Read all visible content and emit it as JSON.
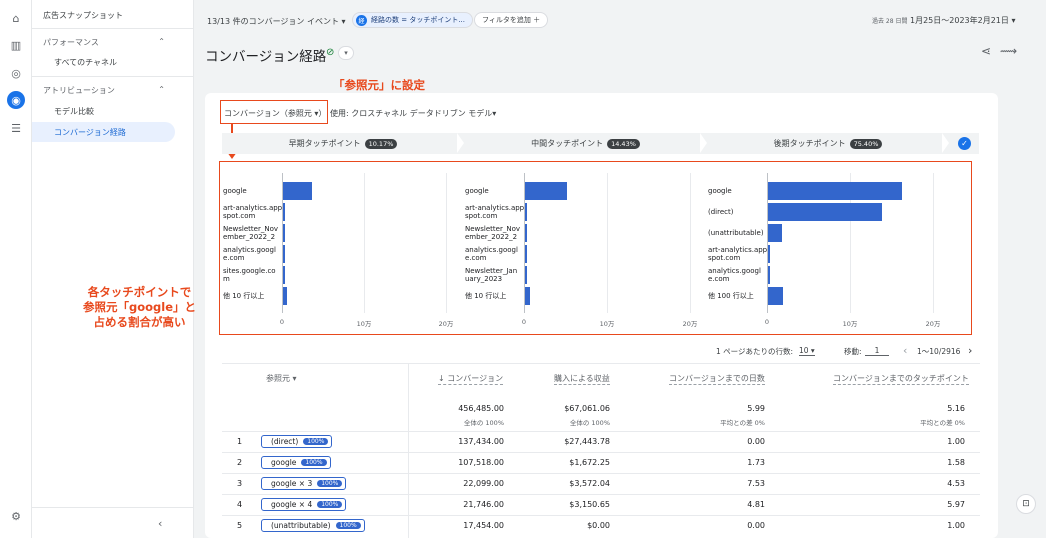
{
  "rail": {
    "icons": [
      "home-icon",
      "reports-icon",
      "explore-icon",
      "advertising-icon",
      "configure-icon",
      "settings-icon"
    ]
  },
  "sidenav": {
    "snapshot": "広告スナップショット",
    "performance": "パフォーマンス",
    "all_channels": "すべてのチャネル",
    "attribution": "アトリビューション",
    "model_compare": "モデル比較",
    "conversion_paths": "コンバージョン経路",
    "collapse": "‹"
  },
  "topbar": {
    "events": "13/13 件のコンバージョン イベント ▾",
    "chip_badge": "経",
    "chip": "経路の数 = タッチポイント...",
    "filter": "フィルタを追加 ＋",
    "range_prefix": "過去 28 日間",
    "range": "1月25日〜2023年2月21日 ▾"
  },
  "page": {
    "title": "コンバージョン経路",
    "check": "⊘",
    "drop": "▾"
  },
  "annotations": {
    "callout": "「参照元」に設定",
    "side": [
      "各タッチポイントで",
      "参照元「google」と",
      "占める割合が高い"
    ]
  },
  "controls": {
    "dimension": "コンバージョン（参照元 ▾）",
    "model": "使用: クロスチャネル データドリブン モデル▾"
  },
  "stages": [
    {
      "label": "早期タッチポイント",
      "pct": "10.17%"
    },
    {
      "label": "中間タッチポイント",
      "pct": "14.43%"
    },
    {
      "label": "後期タッチポイント",
      "pct": "75.40%"
    }
  ],
  "chart_data": [
    {
      "type": "bar",
      "categories": [
        "google",
        "art-analytics.appspot.com",
        "Newsletter_November_2022_2",
        "analytics.google.com",
        "sites.google.com",
        "他 10 行以上"
      ],
      "values": [
        35000,
        2000,
        1500,
        1500,
        1200,
        5000
      ],
      "xticks": [
        "0",
        "10万",
        "20万"
      ],
      "xlim": [
        0,
        200000
      ]
    },
    {
      "type": "bar",
      "categories": [
        "google",
        "art-analytics.appspot.com",
        "Newsletter_November_2022_2",
        "analytics.google.com",
        "Newsletter_January_2023",
        "他 10 行以上"
      ],
      "values": [
        50000,
        2000,
        1500,
        1500,
        1500,
        6000
      ],
      "xticks": [
        "0",
        "10万",
        "20万"
      ],
      "xlim": [
        0,
        200000
      ]
    },
    {
      "type": "bar",
      "categories": [
        "google",
        "(direct)",
        "(unattributable)",
        "art-analytics.appspot.com",
        "analytics.google.com",
        "他 100 行以上"
      ],
      "values": [
        162000,
        137000,
        17000,
        3000,
        2500,
        18000
      ],
      "xticks": [
        "0",
        "10万",
        "20万"
      ],
      "xlim": [
        0,
        200000
      ]
    }
  ],
  "chart_labels": [
    [
      "google",
      "art-analytics.app\nspot.com",
      "Newsletter_Nov\nember_2022_2",
      "analytics.googl\ne.com",
      "sites.google.co\nm",
      "他 10 行以上"
    ],
    [
      "google",
      "art-analytics.app\nspot.com",
      "Newsletter_Nov\nember_2022_2",
      "analytics.googl\ne.com",
      "Newsletter_Jan\nuary_2023",
      "他 10 行以上"
    ],
    [
      "google",
      "(direct)",
      "(unattributable)",
      "art-analytics.app\nspot.com",
      "analytics.googl\ne.com",
      "他 100 行以上"
    ]
  ],
  "pagination": {
    "rows_label": "1 ページあたりの行数:",
    "rows": "10 ▾",
    "goto": "移動:",
    "page": "1",
    "range": "1〜10/2916",
    "prev": "‹",
    "next": "›"
  },
  "table": {
    "headers": [
      "参照元 ▾",
      "↓ コンバージョン",
      "購入による収益",
      "コンバージョンまでの日数",
      "コンバージョンまでのタッチポイント"
    ],
    "totals": [
      "456,485.00",
      "$67,061.06",
      "5.99",
      "5.16"
    ],
    "totals_sub": [
      "全体の 100%",
      "全体の 100%",
      "平均との差 0%",
      "平均との差 0%"
    ],
    "rows": [
      {
        "idx": "1",
        "source": "(direct)",
        "pct": "100%",
        "conv": "137,434.00",
        "rev": "$27,443.78",
        "days": "0.00",
        "tp": "1.00"
      },
      {
        "idx": "2",
        "source": "google",
        "pct": "100%",
        "conv": "107,518.00",
        "rev": "$1,672.25",
        "days": "1.73",
        "tp": "1.58"
      },
      {
        "idx": "3",
        "source": "google × 3",
        "pct": "100%",
        "conv": "22,099.00",
        "rev": "$3,572.04",
        "days": "7.53",
        "tp": "4.53"
      },
      {
        "idx": "4",
        "source": "google × 4",
        "pct": "100%",
        "conv": "21,746.00",
        "rev": "$3,150.65",
        "days": "4.81",
        "tp": "5.97"
      },
      {
        "idx": "5",
        "source": "(unattributable)",
        "pct": "100%",
        "conv": "17,454.00",
        "rev": "$0.00",
        "days": "0.00",
        "tp": "1.00"
      }
    ]
  }
}
